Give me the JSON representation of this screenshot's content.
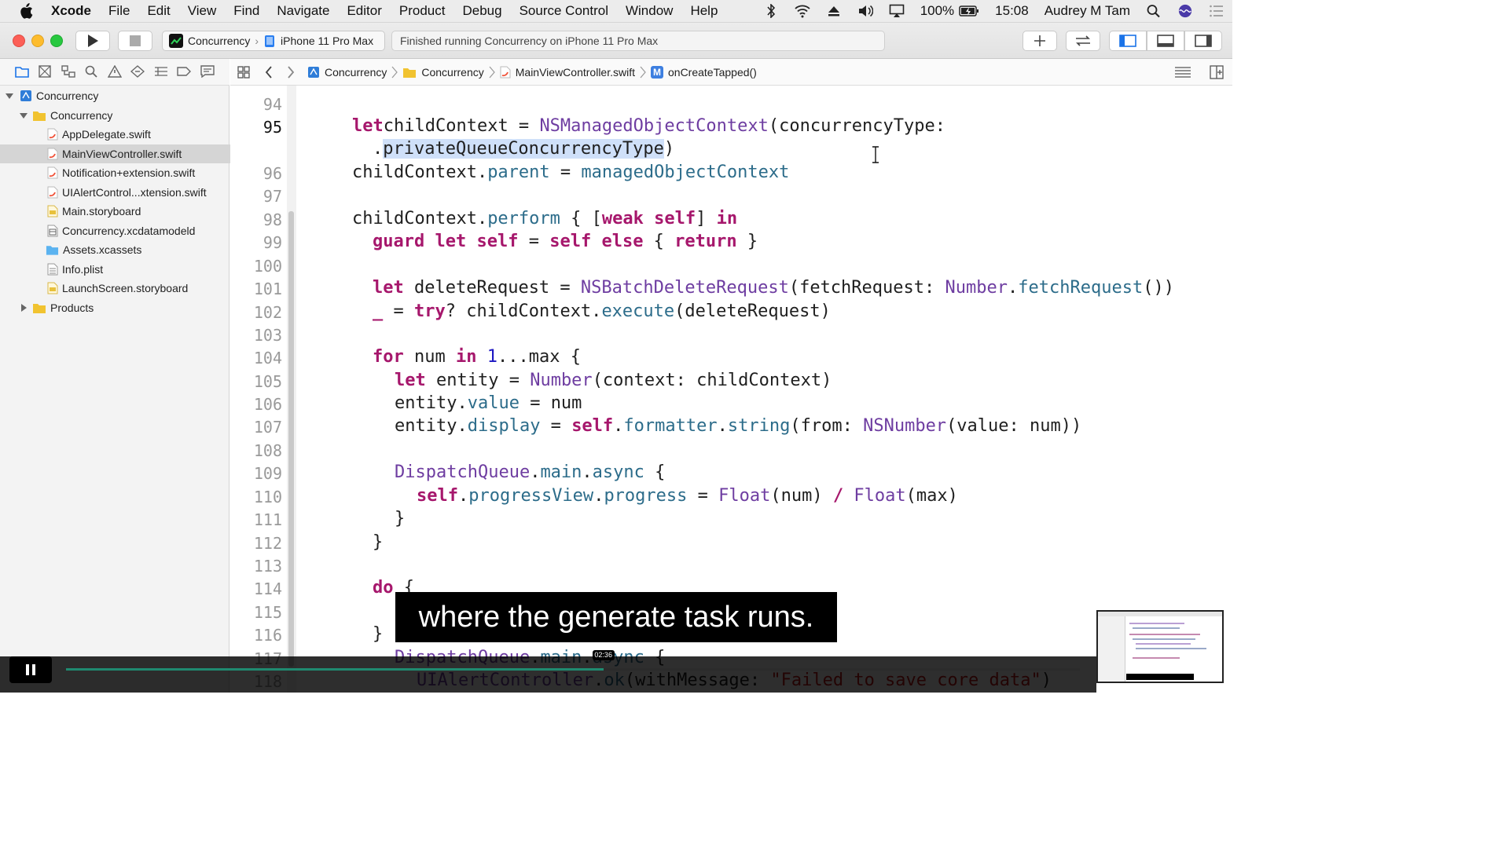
{
  "menubar": {
    "app_name": "Xcode",
    "items": [
      "File",
      "Edit",
      "View",
      "Find",
      "Navigate",
      "Editor",
      "Product",
      "Debug",
      "Source Control",
      "Window",
      "Help"
    ],
    "battery": "100%",
    "time": "15:08",
    "user": "Audrey M Tam"
  },
  "toolbar": {
    "scheme_target": "Concurrency",
    "scheme_device": "iPhone 11 Pro Max",
    "activity_status": "Finished running Concurrency on iPhone 11 Pro Max"
  },
  "navigator": {
    "project": "Concurrency",
    "group": "Concurrency",
    "files": [
      "AppDelegate.swift",
      "MainViewController.swift",
      "Notification+extension.swift",
      "UIAlertControl...xtension.swift",
      "Main.storyboard",
      "Concurrency.xcdatamodeld",
      "Assets.xcassets",
      "Info.plist",
      "LaunchScreen.storyboard"
    ],
    "products_group": "Products"
  },
  "jumpbar": {
    "crumbs": [
      "Concurrency",
      "Concurrency",
      "MainViewController.swift",
      "onCreateTapped()"
    ],
    "method_badge": "M"
  },
  "editor": {
    "line_numbers": [
      "94",
      "95",
      "",
      "96",
      "97",
      "98",
      "99",
      "100",
      "101",
      "102",
      "103",
      "104",
      "105",
      "106",
      "107",
      "108",
      "109",
      "110",
      "111",
      "112",
      "113",
      "114",
      "115",
      "116",
      "117",
      "118"
    ],
    "current_line": "95"
  },
  "overlay": {
    "caption": "where the generate task runs.",
    "timestamp": "02:36",
    "progress": 0.53
  },
  "colors": {
    "keyword": "#a6176c",
    "type": "#6e3da1",
    "property": "#2c6c8a",
    "number": "#1c16c2",
    "string": "#c41a16",
    "selection": "#cfe0f9",
    "progress_fill": "#1f8a70"
  }
}
